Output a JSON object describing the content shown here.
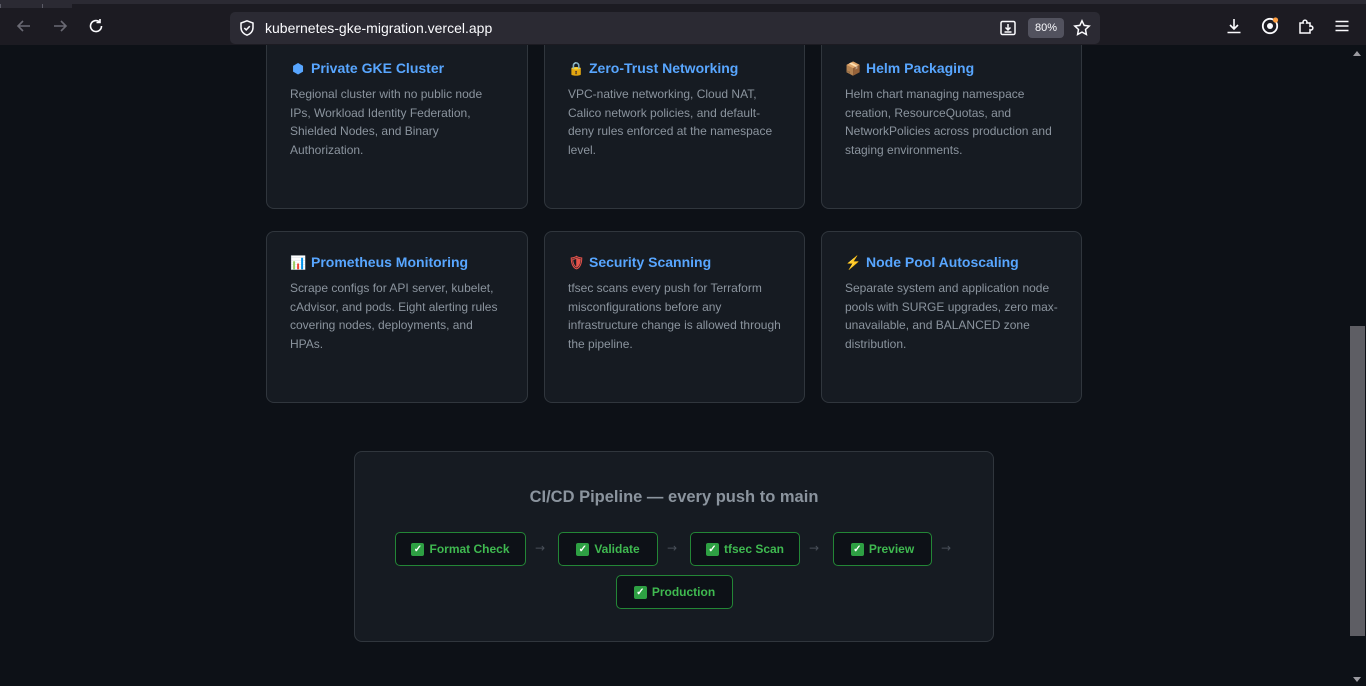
{
  "browser": {
    "url": "kubernetes-gke-migration.vercel.app",
    "zoom": "80%",
    "icons": [
      "back-arrow-icon",
      "forward-arrow-icon",
      "reload-icon",
      "shield-icon",
      "save-page-icon",
      "bookmark-star-icon",
      "downloads-icon",
      "account-icon",
      "extensions-icon",
      "menu-icon"
    ]
  },
  "features": [
    {
      "emoji": "⬢",
      "icon": "kubernetes-icon",
      "title": "Private GKE Cluster",
      "description": "Regional cluster with no public node IPs, Workload Identity Federation, Shielded Nodes, and Binary Authorization."
    },
    {
      "emoji": "🔒",
      "icon": "lock-icon",
      "title": "Zero-Trust Networking",
      "description": "VPC-native networking, Cloud NAT, Calico network policies, and default-deny rules enforced at the namespace level."
    },
    {
      "emoji": "📦",
      "icon": "package-icon",
      "title": "Helm Packaging",
      "description": "Helm chart managing namespace creation, ResourceQuotas, and NetworkPolicies across production and staging environments."
    },
    {
      "emoji": "📊",
      "icon": "bar-chart-icon",
      "title": "Prometheus Monitoring",
      "description": "Scrape configs for API server, kubelet, cAdvisor, and pods. Eight alerting rules covering nodes, deployments, and HPAs."
    },
    {
      "emoji": "🛡",
      "icon": "shield-icon",
      "title": "Security Scanning",
      "description": "tfsec scans every push for Terraform misconfigurations before any infrastructure change is allowed through the pipeline."
    },
    {
      "emoji": "⚡",
      "icon": "lightning-icon",
      "title": "Node Pool Autoscaling",
      "description": "Separate system and application node pools with SURGE upgrades, zero max-unavailable, and BALANCED zone distribution."
    }
  ],
  "pipeline": {
    "title": "CI/CD Pipeline — every push to main",
    "arrow": "→",
    "check": "✓",
    "stages": [
      "Format Check",
      "Validate",
      "tfsec Scan",
      "Preview",
      "Production"
    ]
  },
  "colors": {
    "background": "#0d1117",
    "card": "#161b22",
    "border": "#30363d",
    "accent": "#58a6ff",
    "success": "#3fb950"
  }
}
